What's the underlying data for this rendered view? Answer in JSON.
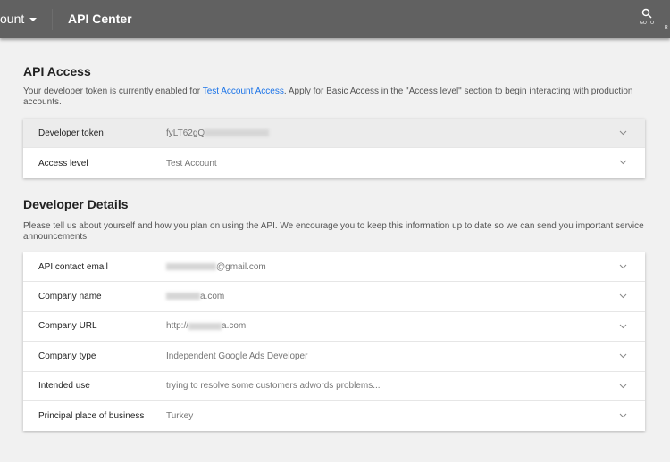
{
  "header": {
    "account_label": "ount",
    "title": "API Center",
    "goto_label": "GO TO",
    "r_label": "R"
  },
  "api_access": {
    "title": "API Access",
    "desc_pre": "Your developer token is currently enabled for ",
    "desc_link": "Test Account Access",
    "desc_post": ". Apply for Basic Access in the \"Access level\" section to begin interacting with production accounts.",
    "rows": [
      {
        "label": "Developer token",
        "value": "fyLT62gQ"
      },
      {
        "label": "Access level",
        "value": "Test Account"
      }
    ]
  },
  "developer_details": {
    "title": "Developer Details",
    "desc": "Please tell us about yourself and how you plan on using the API. We encourage you to keep this information up to date so we can send you important service announcements.",
    "rows": [
      {
        "label": "API contact email",
        "value_pre": "",
        "value": "@gmail.com"
      },
      {
        "label": "Company name",
        "value_pre": "",
        "value": "a.com"
      },
      {
        "label": "Company URL",
        "value_pre": "http://",
        "value": "a.com"
      },
      {
        "label": "Company type",
        "value_pre": "",
        "value": "Independent Google Ads Developer"
      },
      {
        "label": "Intended use",
        "value_pre": "",
        "value": "trying to resolve some customers adwords problems..."
      },
      {
        "label": "Principal place of business",
        "value_pre": "",
        "value": "Turkey"
      }
    ]
  }
}
